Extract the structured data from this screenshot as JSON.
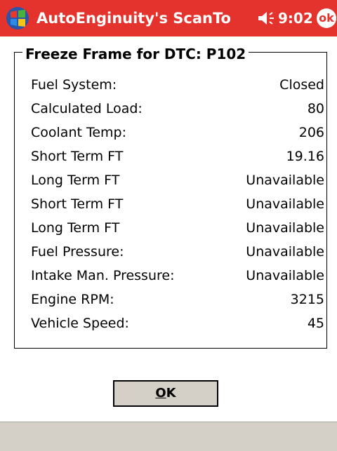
{
  "titlebar": {
    "app_title": "AutoEnginuity's ScanTo",
    "time": "9:02",
    "ok_label": "ok",
    "color": "#e4322d"
  },
  "freeze_frame": {
    "legend": "Freeze Frame for DTC: P102",
    "rows": [
      {
        "label": "Fuel System:",
        "value": "Closed"
      },
      {
        "label": "Calculated Load:",
        "value": "80"
      },
      {
        "label": "Coolant Temp:",
        "value": "206"
      },
      {
        "label": "Short Term FT",
        "value": "19.16"
      },
      {
        "label": "Long Term FT",
        "value": "Unavailable"
      },
      {
        "label": "Short Term FT",
        "value": "Unavailable"
      },
      {
        "label": "Long Term FT",
        "value": "Unavailable"
      },
      {
        "label": "Fuel Pressure:",
        "value": "Unavailable"
      },
      {
        "label": "Intake Man. Pressure:",
        "value": "Unavailable"
      },
      {
        "label": "Engine RPM:",
        "value": "3215"
      },
      {
        "label": "Vehicle Speed:",
        "value": "45"
      }
    ]
  },
  "dialog": {
    "ok_button_accel": "O",
    "ok_button_rest": "K"
  },
  "icons": {
    "start": "windows-flag-icon",
    "volume": "speaker-icon"
  }
}
